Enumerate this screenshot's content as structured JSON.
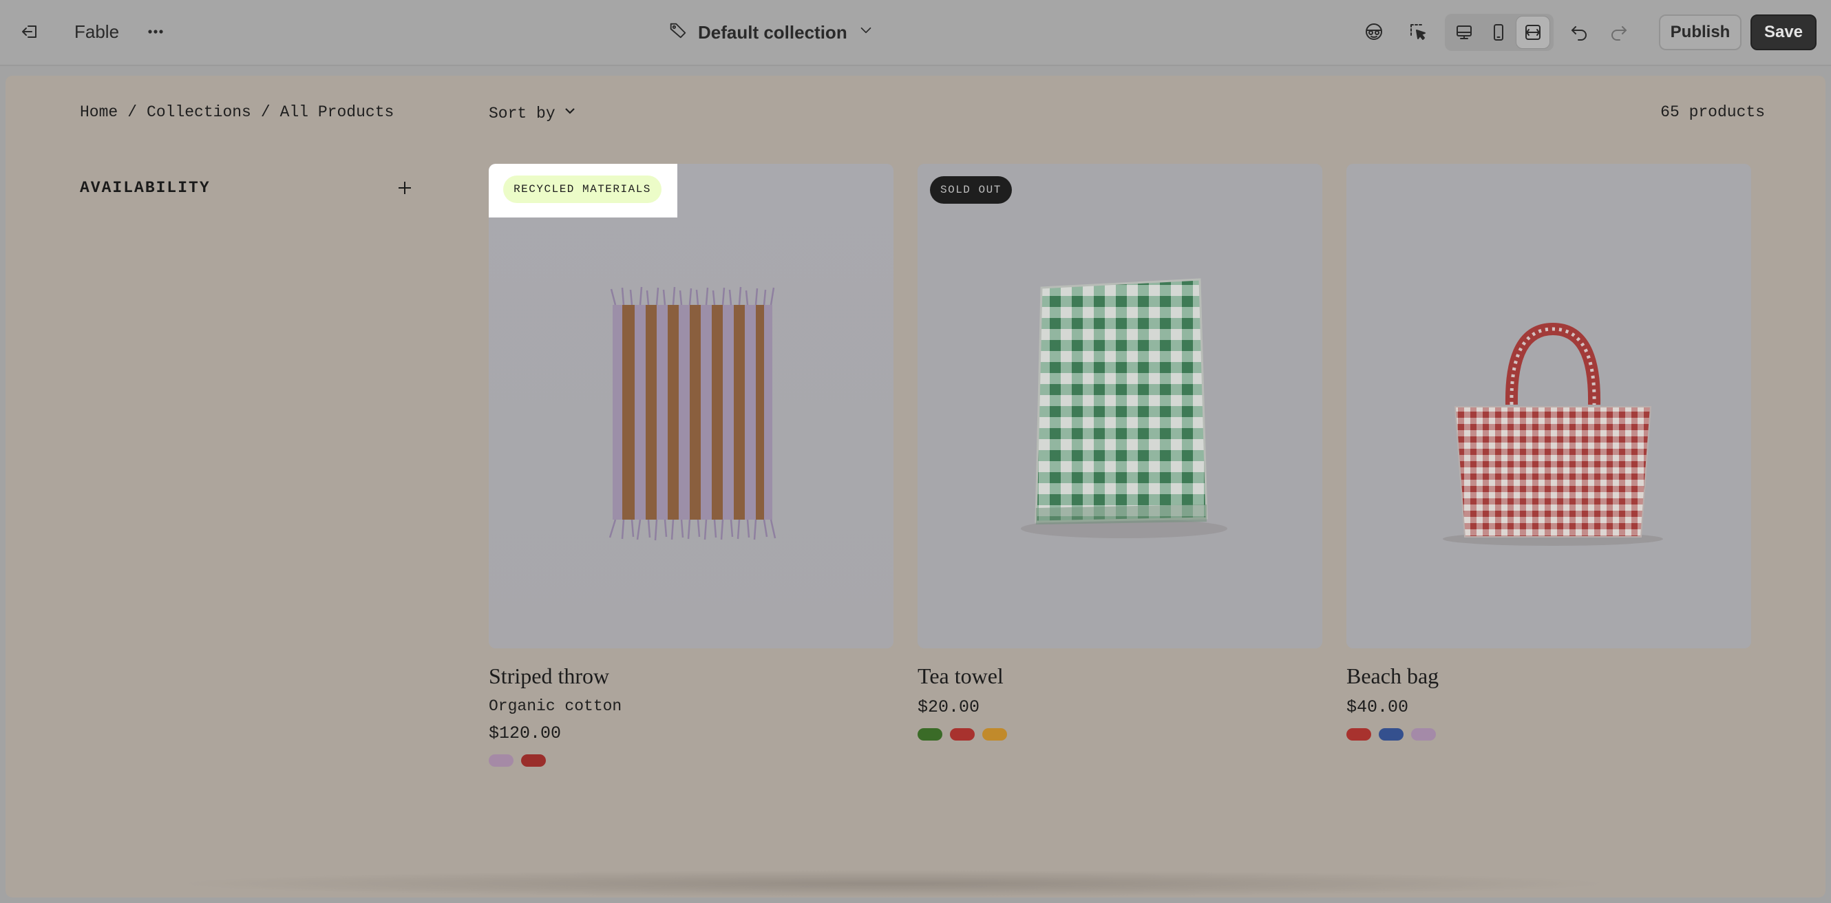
{
  "topbar": {
    "exit_icon": "exit-icon",
    "app_name": "Fable",
    "more_icon": "more-horizontal-icon",
    "collection_icon": "tag-icon",
    "collection_title": "Default collection",
    "collection_chevron": "chevron-down-icon",
    "tools": [
      "face-icon",
      "inspect-select-icon"
    ],
    "views": [
      {
        "name": "desktop-view-icon",
        "active": false
      },
      {
        "name": "mobile-view-icon",
        "active": false
      },
      {
        "name": "fullwidth-view-icon",
        "active": true
      }
    ],
    "undo_icon": "undo-icon",
    "redo_icon": "redo-icon",
    "publish_label": "Publish",
    "save_label": "Save"
  },
  "storefront": {
    "breadcrumb": [
      "Home",
      "/",
      "Collections",
      "/",
      "All Products"
    ],
    "sort_label": "Sort by",
    "product_count": "65 products",
    "filters": [
      {
        "label": "AVAILABILITY",
        "expanded": false
      }
    ],
    "products": [
      {
        "title": "Striped throw",
        "subtitle": "Organic cotton",
        "price": "$120.00",
        "badge": "RECYCLED MATERIALS",
        "badge_style": "highlight",
        "swatches": [
          "#a58aa6",
          "#9a2e2b"
        ]
      },
      {
        "title": "Tea towel",
        "price": "$20.00",
        "badge": "SOLD OUT",
        "badge_style": "dark",
        "swatches": [
          "#3a6b27",
          "#a8322e",
          "#c18a2b"
        ]
      },
      {
        "title": "Beach bag",
        "price": "$40.00",
        "swatches": [
          "#a8322e",
          "#34508e",
          "#a48aa8"
        ]
      }
    ]
  },
  "colors": {
    "editor_bg": "#a6a6a6",
    "preview_bg": "#ada59c",
    "save_button": "#303030",
    "badge_highlight": "#ecfcc8"
  }
}
